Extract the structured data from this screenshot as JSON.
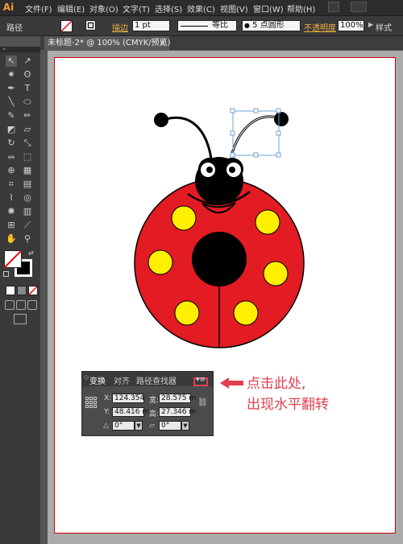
{
  "app": {
    "logo": "Ai"
  },
  "menubar": {
    "items": [
      "文件(F)",
      "编辑(E)",
      "对象(O)",
      "文字(T)",
      "选择(S)",
      "效果(C)",
      "视图(V)",
      "窗口(W)",
      "帮助(H)"
    ]
  },
  "controlbar": {
    "object_label": "路径",
    "stroke_label": "描边",
    "stroke_value": "1 pt",
    "stroke_style": "等比",
    "brush": "5 点圆形",
    "opacity_label": "不透明度",
    "opacity_value": "100%",
    "style_label": "样式"
  },
  "document_tab": {
    "title": "未标题-2* @ 100% (CMYK/预览)",
    "close": "×"
  },
  "transform_panel": {
    "tabs": [
      "变换",
      "对齐",
      "路径查找器"
    ],
    "x_label": "X:",
    "x_value": "124.354",
    "y_label": "Y:",
    "y_value": "48.416 m",
    "w_label": "宽:",
    "w_value": "28.575 m",
    "h_label": "高:",
    "h_value": "27.346 m",
    "rotate_value": "0°",
    "shear_value": "0°",
    "menu_icon": "panel-menu-icon",
    "annotation_line1": "点击此处,",
    "annotation_line2": "出现水平翻转"
  },
  "colors": {
    "body_red": "#e31b23",
    "spot_yellow": "#fff000",
    "annotation_red": "#e04050"
  }
}
